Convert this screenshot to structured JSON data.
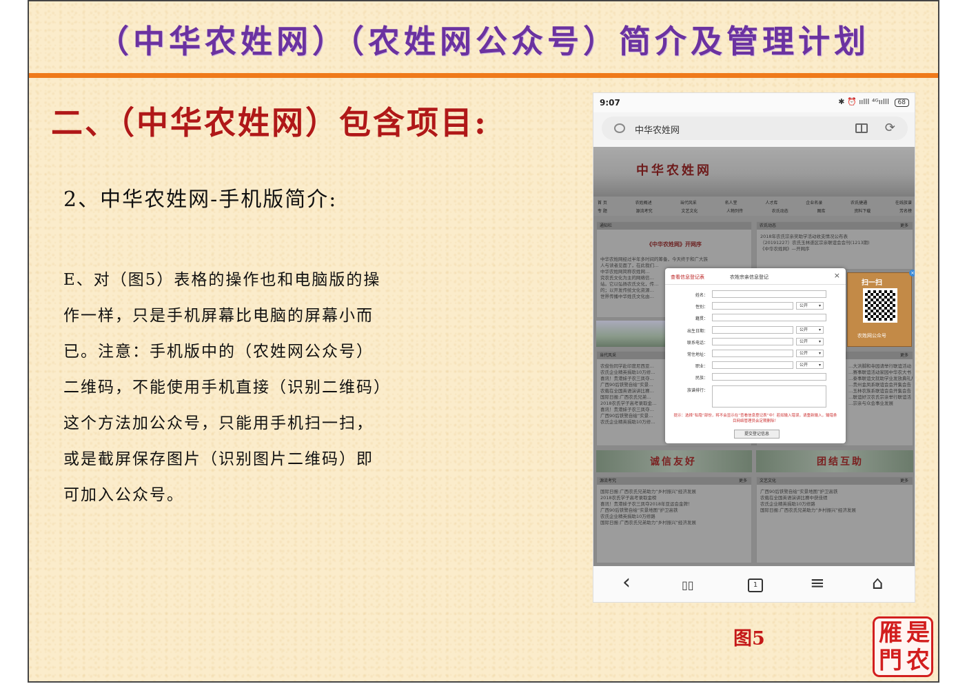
{
  "slide": {
    "header_title": "（中华农姓网）（农姓网公众号）简介及管理计划",
    "section_title": "二、（中华农姓网）包含项目:",
    "sub_title": "2、中华农姓网-手机版简介:",
    "body_lines": [
      "E、对（图5）表格的操作也和电脑版的操",
      "作一样，只是手机屏幕比电脑的屏幕小而",
      "已。注意：手机版中的（农姓网公众号）",
      "二维码，不能使用手机直接（识别二维码）",
      "这个方法加公众号，只能用手机扫一扫，",
      "或是截屏保存图片（识别图片二维码）即",
      "可加入公众号。"
    ],
    "figure_caption": "图5",
    "seal_chars": [
      "是",
      "农",
      "雁",
      "門"
    ]
  },
  "phone": {
    "status_time": "9:07",
    "status_icons": "✱ ⏰ ıılll ⁴ᴳıılll",
    "battery": "68",
    "address_text": "中华农姓网",
    "website": {
      "logo": "中华农姓网",
      "nav_row1": [
        "首 页",
        "农姓概述",
        "当代风采",
        "名人堂",
        "人才库",
        "企业名录",
        "农氏捷通",
        "在线族谱"
      ],
      "nav_row2": [
        "专 题",
        "源流考究",
        "文艺文化",
        "人物列传",
        "农氏动态",
        "图库",
        "资料下载",
        "芳名榜"
      ],
      "notice_head": "通知栏",
      "notice_title": "《中华农姓网》开网序",
      "notice_lines": [
        "中华农姓网经过半年多时间的筹备，今天终于和广大族",
        "人与读者见面了，在此我们…",
        "中华农姓网简称农姓网…",
        "究农氏文化为主的网络信…",
        "站。它以弘扬农氏文化，传…",
        "的；以开发传统文化资源…",
        "世界传播中华姓氏文化由…"
      ],
      "dynamic_head": "农氏动态",
      "dynamic_lines": [
        "2018年农氏宗亲奖助学活动收支情况公布表",
        "（20191227）农氏玉林遂区宗亲联谊会会刊(1213期)",
        "《中华农姓网》—开网序"
      ],
      "style_head": "当代风采",
      "style_lines": [
        "农俊怡同学赴印度尼西亚…",
        "农氏企业精英捐助10万修…",
        "喜讯！贵港妹子农三凤夺…",
        "广西90后铁警自绘“实景…",
        "农载在全国英语演讲比赛…",
        "国际日报:广西农氏兄弟…",
        "2018农氏学子高考录取金…",
        "喜讯！贵港妹子农三凤夺…",
        "广西90后铁警自绘“实景…",
        "农氏企业精英捐助10万修…"
      ],
      "right_lines": [
        "…大洪脚和寺园请举行联谊活动",
        "…赛事联谊活动家园中华农大书",
        "…泰事联谊文就助学业发放典礼局",
        "…贵州金凤系联谊会会开集会告",
        "…玉林农族系联谊会会开集会告",
        "…联谊好汉农氏宗亲举行联谊活",
        "…宗亲与众会事业发展"
      ],
      "banner_left": "诚信友好",
      "banner_right": "团结互助",
      "origin_head": "源流考究",
      "origin_lines": [
        "国际日报:广西农氏兄弟助力“乡村振兴”经济发展",
        "2018农氏学子高考录取金榜",
        "喜讯！贵港妹子农三凤夺2018年亚运会金牌！",
        "广西90后铁警自绘“实景地图”护卫高铁",
        "农氏企业精英捐助10万修路",
        "国际日报:广西农氏兄弟助力“乡村振兴”经济发展"
      ],
      "culture_head": "文艺文化",
      "culture_lines": [
        "广西90后铁警自绘“实景地图”护卫高铁",
        "农载在全国英语演讲比赛中获佳绩",
        "农氏企业精英捐助10万修路",
        "国际日报:广西农氏兄弟助力“乡村振兴”经济发展"
      ],
      "more": "更多",
      "qr": {
        "title": "扫一扫",
        "subtitle": "农姓网公众号"
      },
      "modal": {
        "tab_active": "查看信息登记表",
        "tab_title": "农姓宗亲信息登记",
        "close": "×",
        "fields": [
          {
            "label": "姓名：",
            "select": ""
          },
          {
            "label": "性别：",
            "select": "公开"
          },
          {
            "label": "籍贯：",
            "select": ""
          },
          {
            "label": "出生日期：",
            "select": "公开"
          },
          {
            "label": "联系电话：",
            "select": "公开"
          },
          {
            "label": "常住地址：",
            "select": "公开"
          },
          {
            "label": "职业：",
            "select": "公开"
          },
          {
            "label": "民族：",
            "select": ""
          }
        ],
        "textarea_label": "族谱排行：",
        "tip": "提示：选择“私隐”部份，将不会显示在“查看信息登记表”中！若如输入错误，请重新输入，输错条目网络管理员会定期删除！",
        "submit": "提交登记信息"
      }
    },
    "bottom_nav": {
      "back": "‹",
      "bookmarks": "▯▯",
      "tabs_count": "1",
      "menu": "≡",
      "home": "⌂"
    }
  }
}
